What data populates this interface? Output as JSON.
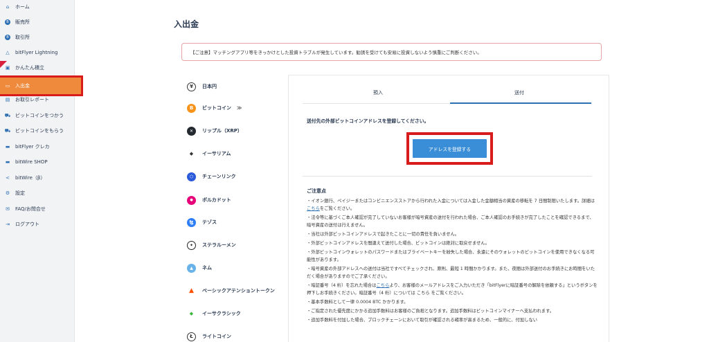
{
  "sidebar": {
    "items": [
      {
        "label": "ホーム",
        "icon": "home-icon"
      },
      {
        "label": "販売所",
        "icon": "bitcoin-icon"
      },
      {
        "label": "取引所",
        "icon": "bitcoin-icon"
      },
      {
        "label": "bitFlyer Lightning",
        "icon": "lightning-icon"
      },
      {
        "label": "かんたん積立",
        "icon": "piggy-bank-icon"
      },
      {
        "label": "入出金",
        "icon": "wallet-icon"
      },
      {
        "label": "お取引レポート",
        "icon": "report-icon"
      },
      {
        "label": "ビットコインをつかう",
        "icon": "cart-icon"
      },
      {
        "label": "ビットコインをもらう",
        "icon": "cart-icon"
      },
      {
        "label": "bitFlyer クレカ",
        "icon": "card-icon"
      },
      {
        "label": "bitWire SHOP",
        "icon": "card-icon"
      },
      {
        "label": "bitWire（β）",
        "icon": "share-icon"
      },
      {
        "label": "設定",
        "icon": "gear-icon"
      },
      {
        "label": "FAQ/お問合せ",
        "icon": "mail-icon"
      },
      {
        "label": "ログアウト",
        "icon": "logout-icon"
      }
    ]
  },
  "page": {
    "title": "入出金",
    "notice": "【ご注意】マッチングアプリ等をきっかけとした投資トラブルが発生しています。勧誘を受けても安易に投資しないよう慎重にご判断ください。"
  },
  "currencies": [
    {
      "label": "日本円",
      "color": "#ffffff",
      "glyph": "¥"
    },
    {
      "label": "ビットコイン",
      "color": "#f7931a",
      "glyph": "B"
    },
    {
      "label": "リップル（XRP）",
      "color": "#23292f",
      "glyph": "✕"
    },
    {
      "label": "イーサリアム",
      "color": "#ffffff",
      "glyph": "◆"
    },
    {
      "label": "チェーンリンク",
      "color": "#2a5ada",
      "glyph": "⬡"
    },
    {
      "label": "ポルカドット",
      "color": "#e6007a",
      "glyph": "●"
    },
    {
      "label": "テゾス",
      "color": "#2c7df7",
      "glyph": "ꜩ"
    },
    {
      "label": "ステラルーメン",
      "color": "#ffffff",
      "glyph": "✦"
    },
    {
      "label": "ネム",
      "color": "#67b2e8",
      "glyph": "▲"
    },
    {
      "label": "ベーシックアテンショントークン",
      "color": "#ff5000",
      "glyph": "▲"
    },
    {
      "label": "イーサクラシック",
      "color": "#3ab83a",
      "glyph": "◆"
    },
    {
      "label": "ライトコイン",
      "color": "#ffffff",
      "glyph": "Ł"
    }
  ],
  "currency_arrows": "≫",
  "panel": {
    "tabs": {
      "deposit": "預入",
      "send": "送付"
    },
    "heading": "送付先の外部ビットコインアドレスを登録してください。",
    "register_button": "アドレスを登録する",
    "notes_title": "ご注意点",
    "notes": [
      {
        "before": "・イオン銀行、ペイジーまたはコンビニエンスストアから行われた入金については入金した金額相当の資産の移転を 7 日間制限いたします。詳細は",
        "link": "こちら",
        "after": "をご覧ください。"
      },
      {
        "before": "・法令等に基づくご本人確認が完了していないお客様が暗号資産の送付を行われた場合、ご本人確認のお手続きが完了したことを確認できるまで、暗号資産の送付は行えません。",
        "link": "",
        "after": ""
      },
      {
        "before": "・当社は外部ビットコインアドレスで起きたことに一切の責任を負いません。",
        "link": "",
        "after": ""
      },
      {
        "before": "・外部ビットコインアドレスを間違えて送付した場合、ビットコインは絶対に取戻せません。",
        "link": "",
        "after": ""
      },
      {
        "before": "・外部ビットコインウォレットのパスワードまたはプライベートキーを紛失した場合、永遠にそのウォレットのビットコインを使用できなくなる可能性があります。",
        "link": "",
        "after": ""
      },
      {
        "before": "・暗号資産の外部アドレスへの送付は当社ですべてチェックされ、原則、最短 1 時間かかります。また、夜間は外部送付のお手続きにお時間をいただく場合がありますのでご了承ください。",
        "link": "",
        "after": ""
      },
      {
        "before": "・暗証番号（4 桁）を忘れた場合は",
        "link": "こちら",
        "after": "より、お客様のメールアドレスをご入力いただき「bitFlyerに暗証番号の解除を依頼する」というボタンを押下しお手続きください。暗証番号（4 桁）については こちら をご覧ください。"
      },
      {
        "before": "・基本手数料として一律 0.0004 BTC かかります。",
        "link": "",
        "after": ""
      },
      {
        "before": "・ご指定された優先度にかかる追加手数料はお客様のご負担となります。追加手数料はビットコインマイナーへ支払われます。",
        "link": "",
        "after": ""
      },
      {
        "before": "・追加手数料を付加した場合、ブロックチェーンにおいて取引が確認される確率が高まるため、一般的に、付加しない",
        "link": "",
        "after": ""
      }
    ]
  }
}
